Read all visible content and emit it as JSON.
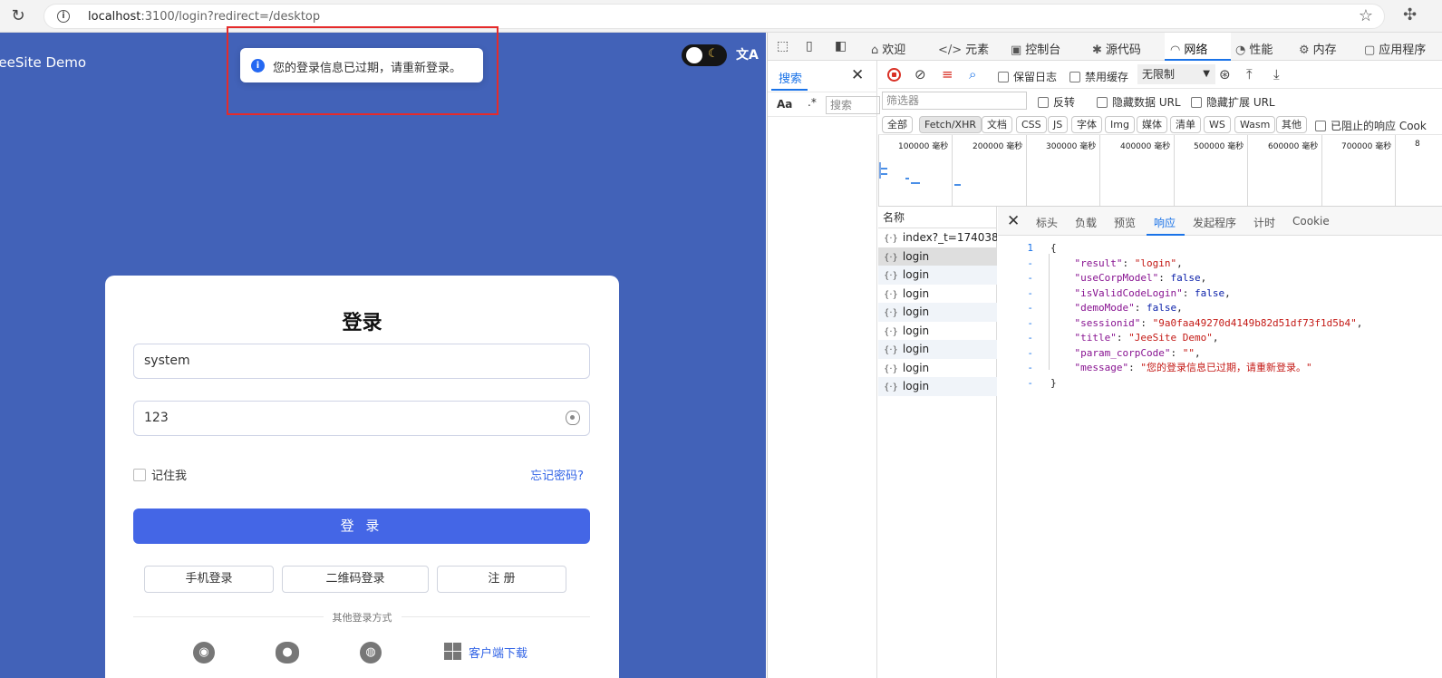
{
  "browser": {
    "url_host": "localhost",
    "url_rest": ":3100/login?redirect=/desktop"
  },
  "app": {
    "brand": "JeeSite Demo",
    "lang_icon": "文A",
    "toast": "您的登录信息已过期，请重新登录。",
    "login": {
      "title": "登录",
      "username": "system",
      "password": "123",
      "remember": "记住我",
      "forgot": "忘记密码?",
      "submit": "登 录",
      "mobile_login": "手机登录",
      "qr_login": "二维码登录",
      "register": "注 册",
      "other_methods": "其他登录方式",
      "client_download": "客户端下载"
    }
  },
  "devtools": {
    "tabs": [
      {
        "label": "欢迎"
      },
      {
        "label": "元素"
      },
      {
        "label": "控制台"
      },
      {
        "label": "源代码"
      },
      {
        "label": "网络"
      },
      {
        "label": "性能"
      },
      {
        "label": "内存"
      },
      {
        "label": "应用程序"
      }
    ],
    "search": {
      "title": "搜索",
      "case_label": "Aa",
      "regex_label": ".*",
      "placeholder": "搜索"
    },
    "network": {
      "preserve_log": "保留日志",
      "disable_cache": "禁用缓存",
      "throttle": "无限制",
      "filter_placeholder": "筛选器",
      "invert": "反转",
      "hide_data_urls": "隐藏数据 URL",
      "hide_ext_urls": "隐藏扩展 URL",
      "types": [
        "全部",
        "Fetch/XHR",
        "文档",
        "CSS",
        "JS",
        "字体",
        "Img",
        "媒体",
        "清单",
        "WS",
        "Wasm",
        "其他"
      ],
      "blocked_label": "已阻止的响应 Cook",
      "timeline": [
        "100000 毫秒",
        "200000 毫秒",
        "300000 毫秒",
        "400000 毫秒",
        "500000 毫秒",
        "600000 毫秒",
        "700000 毫秒",
        "8"
      ],
      "name_header": "名称",
      "requests": [
        "index?_t=174038...",
        "login",
        "login",
        "login",
        "login",
        "login",
        "login",
        "login",
        "login"
      ],
      "detail_tabs": [
        "标头",
        "负载",
        "预览",
        "响应",
        "发起程序",
        "计时",
        "Cookie"
      ],
      "response": {
        "line_numbers": [
          "1",
          "-",
          "-",
          "-",
          "-",
          "-",
          "-",
          "-",
          "-",
          "-"
        ],
        "result": "\"login\"",
        "useCorpModel": "false",
        "isValidCodeLogin": "false",
        "demoMode": "false",
        "sessionid": "\"9a0faa49270d4149b82d51df73f1d5b4\"",
        "title": "\"JeeSite Demo\"",
        "param_corpCode": "\"\"",
        "message": "\"您的登录信息已过期，请重新登录。\""
      }
    }
  }
}
